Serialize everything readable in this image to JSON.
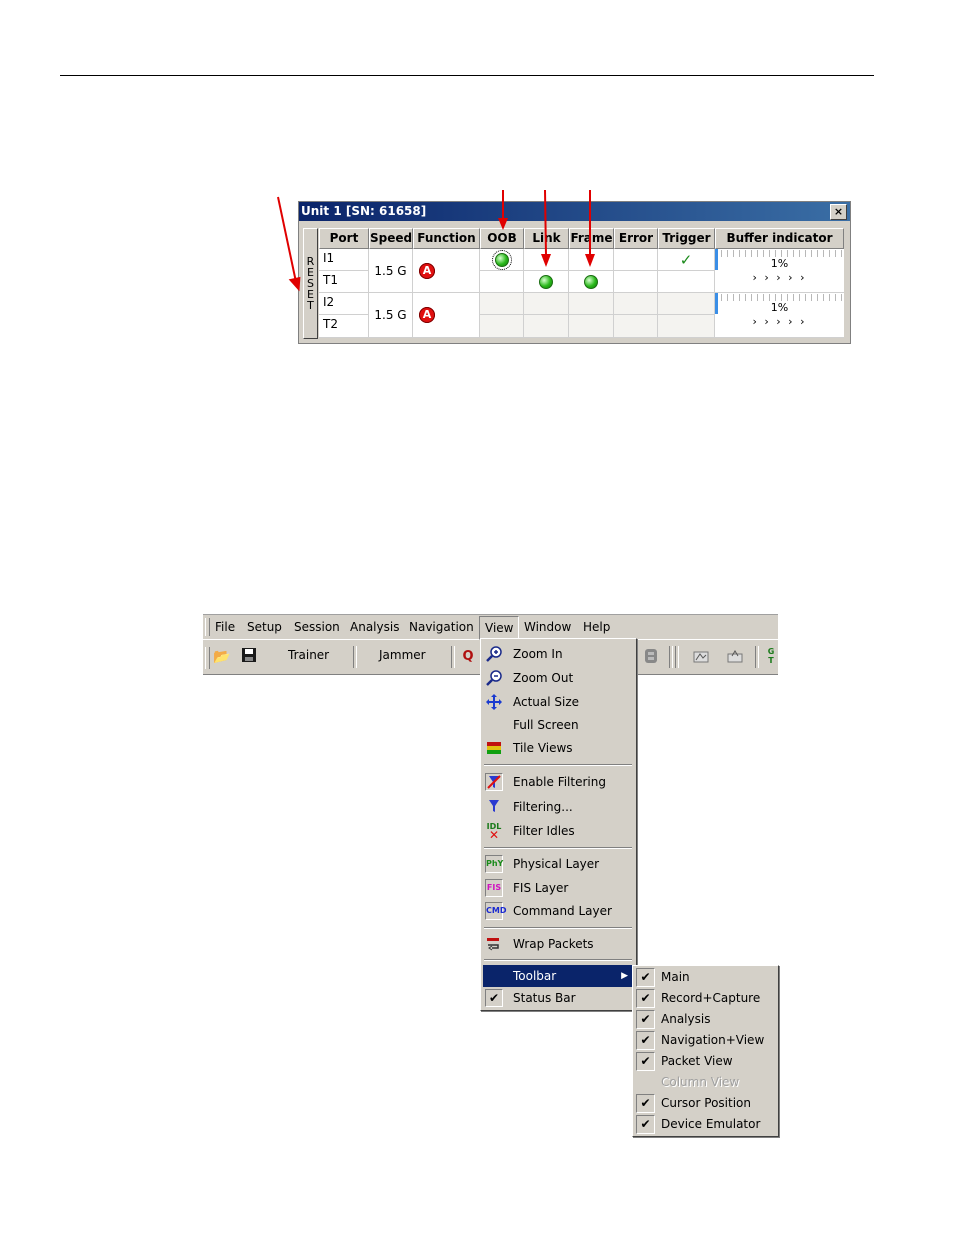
{
  "unit_window": {
    "title": "Unit 1  [SN: 61658]",
    "close": "×",
    "reset_letters": [
      "R",
      "E",
      "S",
      "E",
      "T"
    ],
    "columns": [
      "Port",
      "Speed",
      "Function",
      "OOB",
      "Link",
      "Frame",
      "Error",
      "Trigger",
      "Buffer indicator"
    ],
    "rows": [
      {
        "port_a": "I1",
        "port_b": "T1",
        "speed": "1.5 G",
        "function_icon": "A",
        "buffer_pct": "1%",
        "buffer_arrows": "› › › › ›",
        "buffer_level": 0.01
      },
      {
        "port_a": "I2",
        "port_b": "T2",
        "speed": "1.5 G",
        "function_icon": "A",
        "buffer_pct": "1%",
        "buffer_arrows": "› › › › ›",
        "buffer_level": 0.01
      }
    ],
    "trigger_mark": "✓"
  },
  "menubar": {
    "items": [
      "File",
      "Setup",
      "Session",
      "Analysis",
      "Navigation",
      "View",
      "Window",
      "Help"
    ],
    "active": "View"
  },
  "toolbar": {
    "trainer": "Trainer",
    "jammer": "Jammer"
  },
  "view_menu": {
    "zoom_in": "Zoom In",
    "zoom_out": "Zoom Out",
    "actual_size": "Actual Size",
    "full_screen": "Full Screen",
    "tile_views": "Tile Views",
    "enable_filtering": "Enable Filtering",
    "filtering": "Filtering...",
    "filter_idles": "Filter Idles",
    "physical_layer": "Physical Layer",
    "fis_layer": "FIS Layer",
    "command_layer": "Command Layer",
    "wrap_packets": "Wrap Packets",
    "toolbar": "Toolbar",
    "status_bar": "Status Bar",
    "icon_phy": "PhY",
    "icon_fis": "FIS",
    "icon_cmd": "CMD",
    "icon_idl": "IDL"
  },
  "toolbar_submenu": {
    "items": [
      {
        "label": "Main",
        "checked": true,
        "enabled": true
      },
      {
        "label": "Record+Capture",
        "checked": true,
        "enabled": true
      },
      {
        "label": "Analysis",
        "checked": true,
        "enabled": true
      },
      {
        "label": "Navigation+View",
        "checked": true,
        "enabled": true
      },
      {
        "label": "Packet View",
        "checked": true,
        "enabled": true
      },
      {
        "label": "Column View",
        "checked": false,
        "enabled": false
      },
      {
        "label": "Cursor Position",
        "checked": true,
        "enabled": true
      },
      {
        "label": "Device Emulator",
        "checked": true,
        "enabled": true
      }
    ],
    "check": "✔"
  },
  "colors": {
    "title_bar": "#0a246a",
    "highlight": "#0a246a",
    "annotation_arrow": "#e00000",
    "led_green": "#29b81a",
    "function_red": "#e01010"
  }
}
